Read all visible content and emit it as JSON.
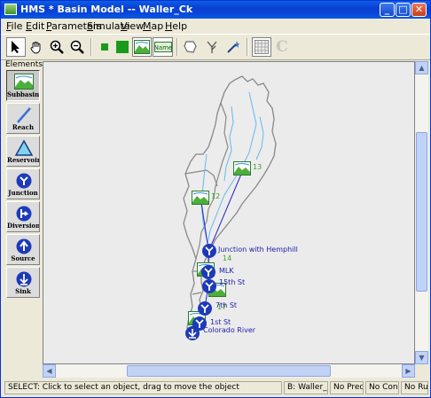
{
  "window": {
    "title": "HMS * Basin Model -- Waller_Ck"
  },
  "titlebar_buttons": {
    "minimize": "_",
    "maximize": "□",
    "close": "✕"
  },
  "menu": [
    {
      "label": "File",
      "accel": "F"
    },
    {
      "label": "Edit",
      "accel": "E"
    },
    {
      "label": "Parameters",
      "accel": "P"
    },
    {
      "label": "Simulate",
      "accel": "S"
    },
    {
      "label": "View",
      "accel": "V"
    },
    {
      "label": "Map",
      "accel": "M"
    },
    {
      "label": "Help",
      "accel": "H"
    }
  ],
  "toolbar": {
    "tools": [
      "select-arrow-icon",
      "hand-pan-icon",
      "zoom-in-icon",
      "zoom-out-icon",
      "small-square-icon",
      "large-square-icon",
      "show-map-icon",
      "show-names-icon",
      "draw-basin-icon",
      "draw-stream-icon",
      "wand-icon",
      "grid-icon",
      "c-icon"
    ],
    "name_label": "Name",
    "c_label": "C"
  },
  "palette": {
    "title": "Elements",
    "items": [
      {
        "label": "Subbasin",
        "icon": "subbasin-icon"
      },
      {
        "label": "Reach",
        "icon": "reach-icon"
      },
      {
        "label": "Reservoir",
        "icon": "reservoir-icon"
      },
      {
        "label": "Junction",
        "icon": "junction-icon"
      },
      {
        "label": "Diversion",
        "icon": "diversion-icon"
      },
      {
        "label": "Source",
        "icon": "source-icon"
      },
      {
        "label": "Sink",
        "icon": "sink-icon"
      }
    ]
  },
  "map": {
    "subbasin_labels": [
      "12",
      "13",
      "14",
      "17"
    ],
    "junction_labels": [
      "Junction with Hemphill",
      "MLK",
      "15th St",
      "7th St",
      "1st St",
      "Colorado River"
    ],
    "colors": {
      "junction": "#1d1da8",
      "link": "#2222cc",
      "stream": "#63b8f0",
      "boundary": "#888888",
      "subbasin_label": "#3f9f2a"
    }
  },
  "statusbar": {
    "message": "SELECT: Click to select an object, drag to move the object",
    "basin": "B: Waller_Ck",
    "precip": "No Precip",
    "control": "No Control",
    "run": "No Run"
  }
}
